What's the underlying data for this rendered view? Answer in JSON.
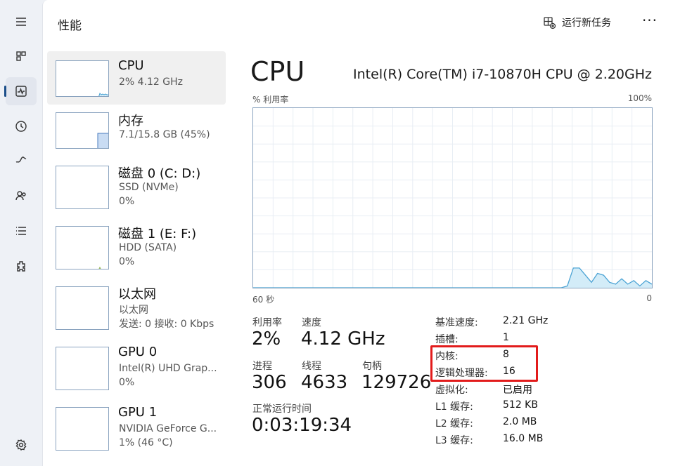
{
  "header": {
    "title": "性能",
    "run_new_task": "运行新任务",
    "more": "···"
  },
  "nav": {
    "icons": [
      "hamburger-icon",
      "processes-icon",
      "performance-icon",
      "app-history-icon",
      "startup-apps-icon",
      "users-icon",
      "details-icon",
      "services-icon",
      "settings-icon"
    ],
    "active": "performance-icon"
  },
  "devices": [
    {
      "name": "CPU",
      "sub1": "2% 4.12 GHz",
      "sub2": "",
      "selected": true
    },
    {
      "name": "内存",
      "sub1": "7.1/15.8 GB (45%)",
      "sub2": ""
    },
    {
      "name": "磁盘 0 (C: D:)",
      "sub1": "SSD (NVMe)",
      "sub2": "0%"
    },
    {
      "name": "磁盘 1 (E: F:)",
      "sub1": "HDD (SATA)",
      "sub2": "0%"
    },
    {
      "name": "以太网",
      "sub1": "以太网",
      "sub2": "发送: 0 接收: 0 Kbps"
    },
    {
      "name": "GPU 0",
      "sub1": "Intel(R) UHD Grap...",
      "sub2": "0%"
    },
    {
      "name": "GPU 1",
      "sub1": "NVIDIA GeForce G...",
      "sub2": "1% (46 °C)"
    }
  ],
  "detail": {
    "title": "CPU",
    "model": "Intel(R) Core(TM) i7-10870H CPU @ 2.20GHz",
    "graph_label": "% 利用率",
    "graph_max": "100%",
    "graph_time": "60 秒",
    "graph_zero": "0",
    "utilization_label": "利用率",
    "utilization": "2%",
    "speed_label": "速度",
    "speed": "4.12 GHz",
    "processes_label": "进程",
    "processes": "306",
    "threads_label": "线程",
    "threads": "4633",
    "handles_label": "句柄",
    "handles": "129726",
    "uptime_label": "正常运行时间",
    "uptime": "0:03:19:34"
  },
  "specs": [
    {
      "label": "基准速度:",
      "value": "2.21 GHz"
    },
    {
      "label": "插槽:",
      "value": "1"
    },
    {
      "label": "内核:",
      "value": "8"
    },
    {
      "label": "逻辑处理器:",
      "value": "16"
    },
    {
      "label": "虚拟化:",
      "value": "已启用"
    },
    {
      "label": "L1 缓存:",
      "value": "512 KB"
    },
    {
      "label": "L2 缓存:",
      "value": "2.0 MB"
    },
    {
      "label": "L3 缓存:",
      "value": "16.0 MB"
    }
  ],
  "colors": {
    "accent": "#1c4f8a",
    "graph_line": "#4ba3d4",
    "graph_fill": "#d3ecf8",
    "grid": "#e8eef4",
    "highlight": "#e21b1b"
  },
  "chart_data": {
    "type": "area",
    "ylabel": "% 利用率",
    "ylim": [
      0,
      100
    ],
    "xlabel": "60 秒",
    "values": [
      0,
      0,
      0,
      0,
      0,
      0,
      0,
      0,
      0,
      0,
      0,
      0,
      0,
      0,
      0,
      0,
      0,
      0,
      0,
      0,
      0,
      0,
      0,
      0,
      0,
      0,
      0,
      0,
      0,
      0,
      0,
      0,
      0,
      0,
      0,
      0,
      0,
      0,
      0,
      0,
      0,
      0,
      0,
      0,
      0,
      0,
      0,
      0,
      0,
      0,
      0,
      0,
      1,
      11,
      11,
      7,
      3,
      8,
      7,
      3,
      2,
      5,
      2,
      4,
      1,
      4,
      2
    ]
  }
}
